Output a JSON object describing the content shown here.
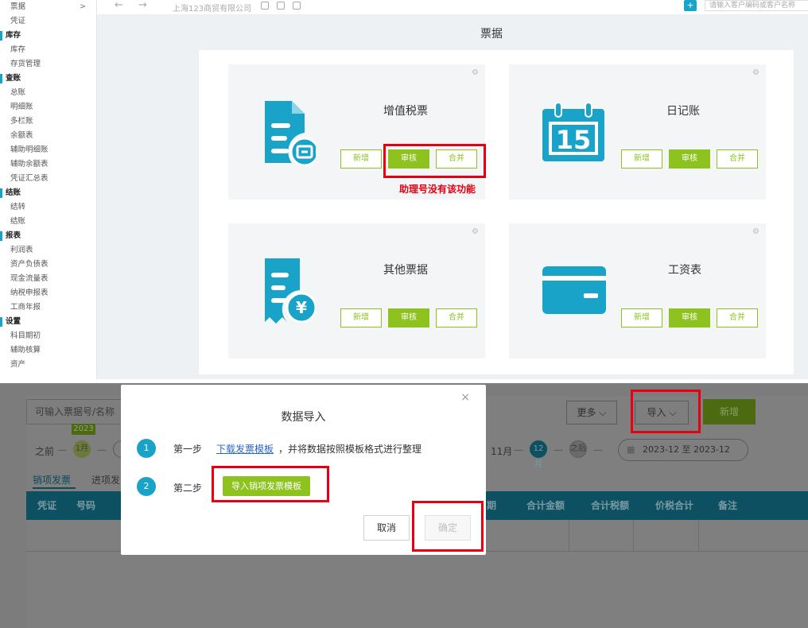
{
  "sidebar": {
    "items": [
      {
        "label": "票据",
        "type": "item",
        "chevron": ">"
      },
      {
        "label": "凭证",
        "type": "item"
      },
      {
        "label": "库存",
        "type": "group"
      },
      {
        "label": "库存",
        "type": "item"
      },
      {
        "label": "存货管理",
        "type": "item"
      },
      {
        "label": "查账",
        "type": "group"
      },
      {
        "label": "总账",
        "type": "item"
      },
      {
        "label": "明细账",
        "type": "item"
      },
      {
        "label": "多栏账",
        "type": "item"
      },
      {
        "label": "余额表",
        "type": "item"
      },
      {
        "label": "辅助明细账",
        "type": "item"
      },
      {
        "label": "辅助余额表",
        "type": "item"
      },
      {
        "label": "凭证汇总表",
        "type": "item"
      },
      {
        "label": "结账",
        "type": "group"
      },
      {
        "label": "结转",
        "type": "item"
      },
      {
        "label": "结账",
        "type": "item"
      },
      {
        "label": "报表",
        "type": "group"
      },
      {
        "label": "利润表",
        "type": "item"
      },
      {
        "label": "资产负债表",
        "type": "item"
      },
      {
        "label": "现金流量表",
        "type": "item"
      },
      {
        "label": "纳税申报表",
        "type": "item"
      },
      {
        "label": "工商年报",
        "type": "item"
      },
      {
        "label": "设置",
        "type": "group"
      },
      {
        "label": "科目期初",
        "type": "item"
      },
      {
        "label": "辅助核算",
        "type": "item"
      },
      {
        "label": "资产",
        "type": "item"
      }
    ]
  },
  "topbar": {
    "back": "←",
    "forward": "→",
    "company": "上海123商贸有限公司",
    "plus": "+",
    "search_placeholder": "请输入客户编码或客户名称"
  },
  "page": {
    "title": "票据",
    "cards": [
      {
        "key": "vat",
        "title": "增值税票",
        "buttons": [
          "新增",
          "审核",
          "合并"
        ]
      },
      {
        "key": "diary",
        "title": "日记账",
        "calendar_day": "15",
        "buttons": [
          "新增",
          "审核",
          "合并"
        ]
      },
      {
        "key": "other",
        "title": "其他票据",
        "buttons": [
          "新增",
          "审核",
          "合并"
        ]
      },
      {
        "key": "salary",
        "title": "工资表",
        "buttons": [
          "新增",
          "审核",
          "合并"
        ]
      }
    ],
    "warning": "助理号没有该功能"
  },
  "background": {
    "search_placeholder": "可输入票据号/名称",
    "more": "更多",
    "import": "导入",
    "new": "新增",
    "year_tag": "2023",
    "before": "之前",
    "month_1": "1月",
    "month_11": "11月",
    "month_12": "12月",
    "after": "之后",
    "range_from": "2023-12",
    "range_to": "至",
    "range_end": "2023-12",
    "tab_sales": "销项发票",
    "tab_purchase": "进项发",
    "columns": [
      "凭证",
      "号码",
      "期",
      "合计金额",
      "合计税额",
      "价税合计",
      "备注"
    ]
  },
  "modal": {
    "title": "数据导入",
    "close": "×",
    "step1_num": "1",
    "step1_label": "第一步",
    "step1_link": "下载发票模板",
    "step1_rest": "，并将数据按照模板格式进行整理",
    "step2_num": "2",
    "step2_label": "第二步",
    "step2_button": "导入销项发票模板",
    "cancel": "取消",
    "ok": "确定"
  },
  "colors": {
    "accent": "#1aa3c8",
    "green": "#8dc21f",
    "highlight": "#e60012"
  }
}
